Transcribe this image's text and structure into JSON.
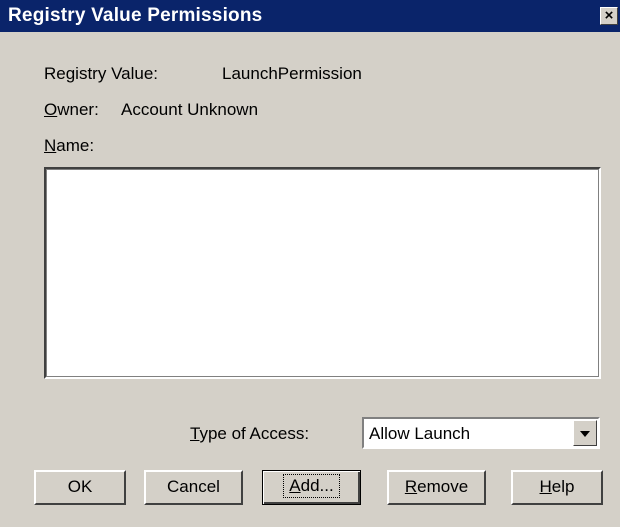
{
  "window": {
    "title": "Registry Value Permissions",
    "close_label": "×"
  },
  "info": {
    "registry_value_label": "Registry Value:",
    "registry_value": "LaunchPermission",
    "owner_label_mnemonic": "O",
    "owner_label_rest": "wner:",
    "owner_value": "Account Unknown",
    "name_label_mnemonic": "N",
    "name_label_rest": "ame:"
  },
  "names_list": {
    "items": []
  },
  "access": {
    "label_mnemonic": "T",
    "label_rest": "ype of Access:",
    "selected": "Allow Launch"
  },
  "buttons": {
    "ok": "OK",
    "cancel": "Cancel",
    "add_mnemonic": "A",
    "add_rest": "dd...",
    "remove_mnemonic": "R",
    "remove_rest": "emove",
    "help_mnemonic": "H",
    "help_rest": "elp"
  },
  "colors": {
    "title_bar": "#0a246a",
    "dialog_face": "#d4d0c8"
  },
  "icons": {
    "close": "close-icon",
    "dropdown": "chevron-down-icon"
  }
}
